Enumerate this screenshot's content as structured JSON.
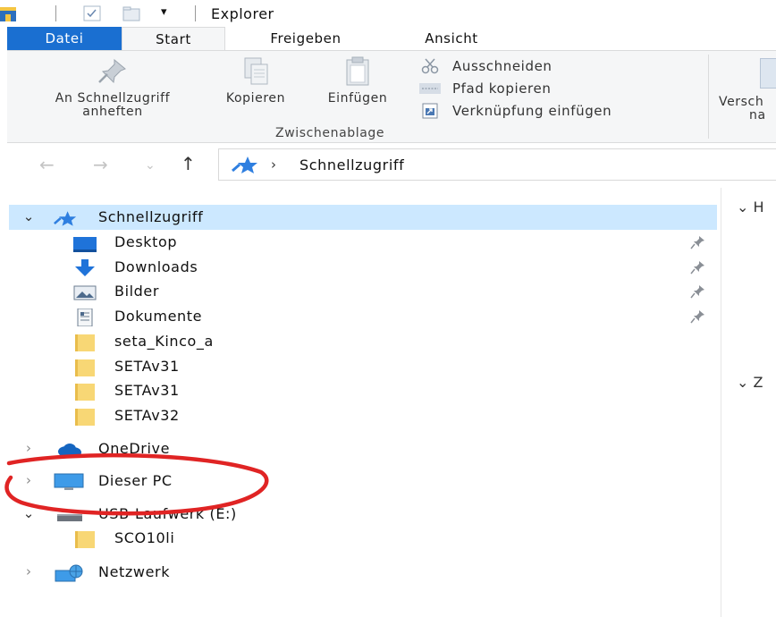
{
  "window": {
    "title": "Explorer"
  },
  "tabs": [
    {
      "id": "datei",
      "label": "Datei"
    },
    {
      "id": "start",
      "label": "Start"
    },
    {
      "id": "freigeben",
      "label": "Freigeben"
    },
    {
      "id": "ansicht",
      "label": "Ansicht"
    }
  ],
  "ribbon": {
    "pin": {
      "line1": "An Schnellzugriff",
      "line2": "anheften"
    },
    "copy": "Kopieren",
    "paste": "Einfügen",
    "cut": "Ausschneiden",
    "copy_path": "Pfad kopieren",
    "paste_link": "Verknüpfung einfügen",
    "group_label": "Zwischenablage",
    "move": {
      "line1": "Versch",
      "line2": "na"
    }
  },
  "address": {
    "separator": "›",
    "location": "Schnellzugriff"
  },
  "nav": {
    "items": [
      {
        "label": "Schnellzugriff",
        "icon": "quick-access-star-icon"
      },
      {
        "label": "Desktop",
        "icon": "desktop-icon",
        "pinned": true
      },
      {
        "label": "Downloads",
        "icon": "download-arrow-icon",
        "pinned": true
      },
      {
        "label": "Bilder",
        "icon": "pictures-icon",
        "pinned": true
      },
      {
        "label": "Dokumente",
        "icon": "documents-icon",
        "pinned": true
      },
      {
        "label": "seta_Kinco_a",
        "icon": "folder-icon"
      },
      {
        "label": "SETAv31",
        "icon": "folder-icon"
      },
      {
        "label": "SETAv31",
        "icon": "folder-icon"
      },
      {
        "label": "SETAv32",
        "icon": "folder-icon"
      },
      {
        "label": "OneDrive",
        "icon": "cloud-icon"
      },
      {
        "label": "Dieser PC",
        "icon": "monitor-icon"
      },
      {
        "label": "USB-Laufwerk (E:)",
        "icon": "usb-drive-icon"
      },
      {
        "label": "SCO10li",
        "icon": "folder-icon"
      },
      {
        "label": "Netzwerk",
        "icon": "network-icon"
      }
    ]
  },
  "content": {
    "heading1": "H",
    "heading2": "Z"
  },
  "colors": {
    "accent": "#1a6fd1",
    "selection": "#cce8ff",
    "annotation": "#e02424",
    "folder": "#f8d775"
  }
}
